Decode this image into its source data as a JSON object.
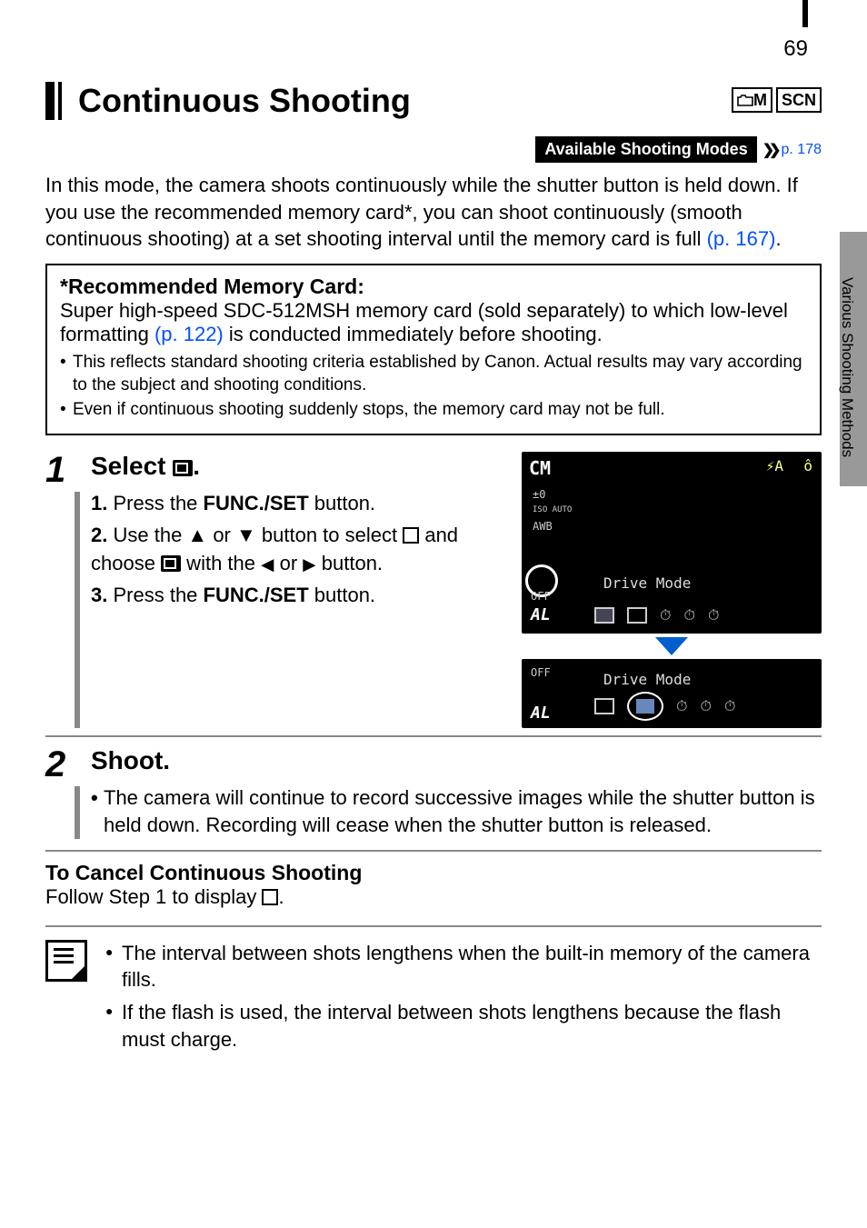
{
  "page_number": "69",
  "side_label": "Various Shooting Methods",
  "title": "Continuous Shooting",
  "mode_icons": {
    "m1": "■M",
    "m2": "SCN",
    "m1_camera": "•"
  },
  "modes_bar": {
    "label": "Available Shooting Modes",
    "link": "p. 178"
  },
  "intro_parts": {
    "p1": "In this mode, the camera shoots continuously while the shutter button is held down. If you use the recommended memory card*, you can shoot continuously (smooth continuous shooting) at a set shooting interval until the memory card is full ",
    "link": "(p. 167)",
    "p2": "."
  },
  "box": {
    "title": "*Recommended Memory Card:",
    "body_a": "Super high-speed SDC-512MSH memory card (sold separately) to which low-level formatting ",
    "link": "(p. 122)",
    "body_b": " is conducted immediately before shooting.",
    "bullets": [
      "This reflects standard shooting criteria established by Canon. Actual results may vary according to the subject and shooting conditions.",
      "Even if continuous shooting suddenly stops, the memory card may not be full."
    ]
  },
  "steps": {
    "s1": {
      "num": "1",
      "heading_pre": "Select ",
      "heading_post": ".",
      "li1_pre": "1.",
      "li1_text_a": "Press the ",
      "li1_bold": "FUNC./SET",
      "li1_text_b": " button.",
      "li2_pre": "2.",
      "li2_a": "Use the ",
      "li2_b": " or ",
      "li2_c": " button to select ",
      "li2_d": " and choose ",
      "li2_e": " with the ",
      "li2_f": " or ",
      "li2_g": " button.",
      "li3_pre": "3.",
      "li3_text_a": "Press the ",
      "li3_bold": "FUNC./SET",
      "li3_text_b": " button."
    },
    "s2": {
      "num": "2",
      "heading": "Shoot.",
      "bullet": "The camera will continue to record successive images while the shutter button is held down. Recording will cease when the shutter button is released."
    }
  },
  "cancel": {
    "title": "To Cancel Continuous Shooting",
    "text_a": "Follow Step 1 to display ",
    "text_b": "."
  },
  "notes": [
    "The interval between shots lengthens when the built-in memory of the camera fills.",
    "If the flash is used, the interval between shots lengthens because the flash must charge."
  ],
  "screen": {
    "cm": "CM",
    "flash": "⚡A",
    "lock": "ô",
    "ev": "±0",
    "iso": "ISO\nAUTO",
    "awb": "AWB",
    "off": "OFF",
    "al": "AL",
    "drive_label": "Drive Mode"
  }
}
